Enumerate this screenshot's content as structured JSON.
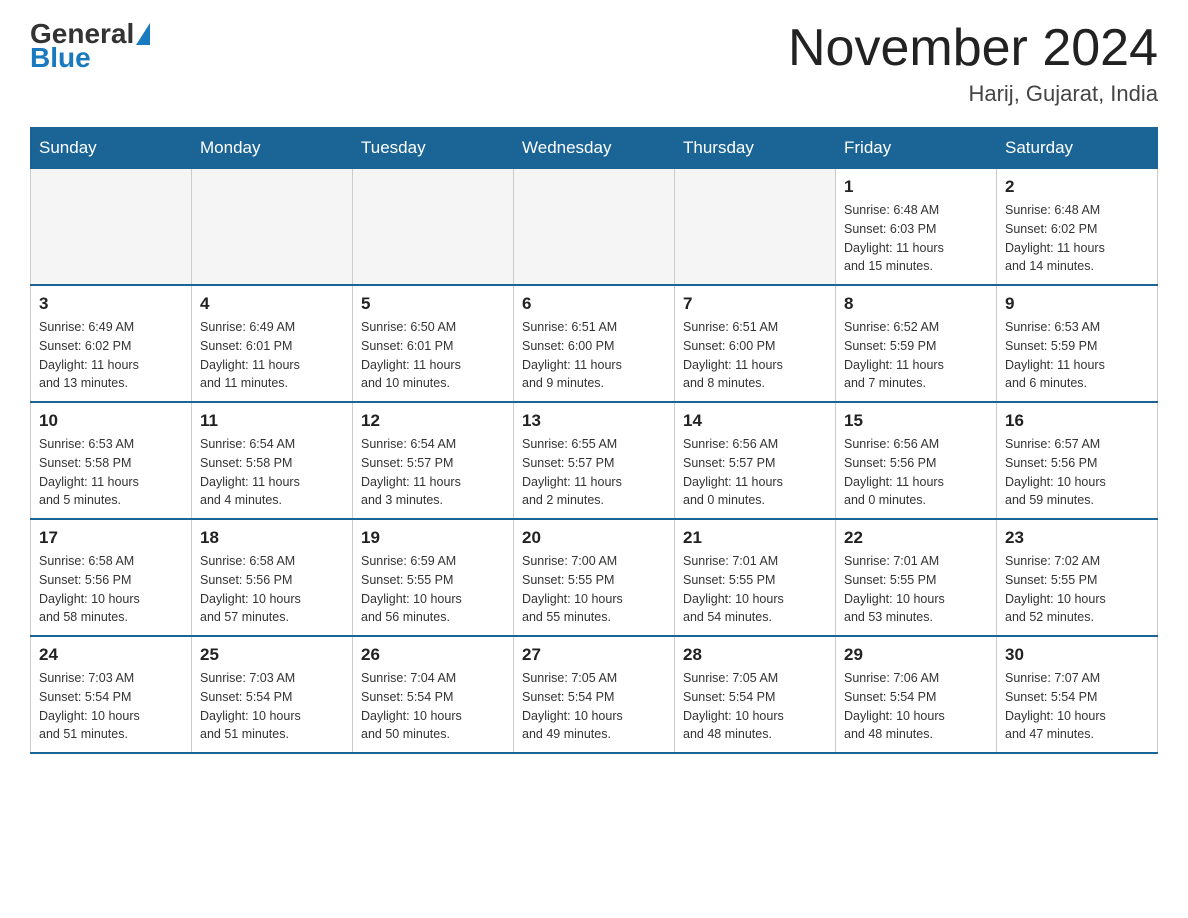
{
  "header": {
    "logo_general": "General",
    "logo_blue": "Blue",
    "month": "November 2024",
    "location": "Harij, Gujarat, India"
  },
  "weekdays": [
    "Sunday",
    "Monday",
    "Tuesday",
    "Wednesday",
    "Thursday",
    "Friday",
    "Saturday"
  ],
  "weeks": [
    [
      {
        "day": "",
        "info": ""
      },
      {
        "day": "",
        "info": ""
      },
      {
        "day": "",
        "info": ""
      },
      {
        "day": "",
        "info": ""
      },
      {
        "day": "",
        "info": ""
      },
      {
        "day": "1",
        "info": "Sunrise: 6:48 AM\nSunset: 6:03 PM\nDaylight: 11 hours\nand 15 minutes."
      },
      {
        "day": "2",
        "info": "Sunrise: 6:48 AM\nSunset: 6:02 PM\nDaylight: 11 hours\nand 14 minutes."
      }
    ],
    [
      {
        "day": "3",
        "info": "Sunrise: 6:49 AM\nSunset: 6:02 PM\nDaylight: 11 hours\nand 13 minutes."
      },
      {
        "day": "4",
        "info": "Sunrise: 6:49 AM\nSunset: 6:01 PM\nDaylight: 11 hours\nand 11 minutes."
      },
      {
        "day": "5",
        "info": "Sunrise: 6:50 AM\nSunset: 6:01 PM\nDaylight: 11 hours\nand 10 minutes."
      },
      {
        "day": "6",
        "info": "Sunrise: 6:51 AM\nSunset: 6:00 PM\nDaylight: 11 hours\nand 9 minutes."
      },
      {
        "day": "7",
        "info": "Sunrise: 6:51 AM\nSunset: 6:00 PM\nDaylight: 11 hours\nand 8 minutes."
      },
      {
        "day": "8",
        "info": "Sunrise: 6:52 AM\nSunset: 5:59 PM\nDaylight: 11 hours\nand 7 minutes."
      },
      {
        "day": "9",
        "info": "Sunrise: 6:53 AM\nSunset: 5:59 PM\nDaylight: 11 hours\nand 6 minutes."
      }
    ],
    [
      {
        "day": "10",
        "info": "Sunrise: 6:53 AM\nSunset: 5:58 PM\nDaylight: 11 hours\nand 5 minutes."
      },
      {
        "day": "11",
        "info": "Sunrise: 6:54 AM\nSunset: 5:58 PM\nDaylight: 11 hours\nand 4 minutes."
      },
      {
        "day": "12",
        "info": "Sunrise: 6:54 AM\nSunset: 5:57 PM\nDaylight: 11 hours\nand 3 minutes."
      },
      {
        "day": "13",
        "info": "Sunrise: 6:55 AM\nSunset: 5:57 PM\nDaylight: 11 hours\nand 2 minutes."
      },
      {
        "day": "14",
        "info": "Sunrise: 6:56 AM\nSunset: 5:57 PM\nDaylight: 11 hours\nand 0 minutes."
      },
      {
        "day": "15",
        "info": "Sunrise: 6:56 AM\nSunset: 5:56 PM\nDaylight: 11 hours\nand 0 minutes."
      },
      {
        "day": "16",
        "info": "Sunrise: 6:57 AM\nSunset: 5:56 PM\nDaylight: 10 hours\nand 59 minutes."
      }
    ],
    [
      {
        "day": "17",
        "info": "Sunrise: 6:58 AM\nSunset: 5:56 PM\nDaylight: 10 hours\nand 58 minutes."
      },
      {
        "day": "18",
        "info": "Sunrise: 6:58 AM\nSunset: 5:56 PM\nDaylight: 10 hours\nand 57 minutes."
      },
      {
        "day": "19",
        "info": "Sunrise: 6:59 AM\nSunset: 5:55 PM\nDaylight: 10 hours\nand 56 minutes."
      },
      {
        "day": "20",
        "info": "Sunrise: 7:00 AM\nSunset: 5:55 PM\nDaylight: 10 hours\nand 55 minutes."
      },
      {
        "day": "21",
        "info": "Sunrise: 7:01 AM\nSunset: 5:55 PM\nDaylight: 10 hours\nand 54 minutes."
      },
      {
        "day": "22",
        "info": "Sunrise: 7:01 AM\nSunset: 5:55 PM\nDaylight: 10 hours\nand 53 minutes."
      },
      {
        "day": "23",
        "info": "Sunrise: 7:02 AM\nSunset: 5:55 PM\nDaylight: 10 hours\nand 52 minutes."
      }
    ],
    [
      {
        "day": "24",
        "info": "Sunrise: 7:03 AM\nSunset: 5:54 PM\nDaylight: 10 hours\nand 51 minutes."
      },
      {
        "day": "25",
        "info": "Sunrise: 7:03 AM\nSunset: 5:54 PM\nDaylight: 10 hours\nand 51 minutes."
      },
      {
        "day": "26",
        "info": "Sunrise: 7:04 AM\nSunset: 5:54 PM\nDaylight: 10 hours\nand 50 minutes."
      },
      {
        "day": "27",
        "info": "Sunrise: 7:05 AM\nSunset: 5:54 PM\nDaylight: 10 hours\nand 49 minutes."
      },
      {
        "day": "28",
        "info": "Sunrise: 7:05 AM\nSunset: 5:54 PM\nDaylight: 10 hours\nand 48 minutes."
      },
      {
        "day": "29",
        "info": "Sunrise: 7:06 AM\nSunset: 5:54 PM\nDaylight: 10 hours\nand 48 minutes."
      },
      {
        "day": "30",
        "info": "Sunrise: 7:07 AM\nSunset: 5:54 PM\nDaylight: 10 hours\nand 47 minutes."
      }
    ]
  ]
}
